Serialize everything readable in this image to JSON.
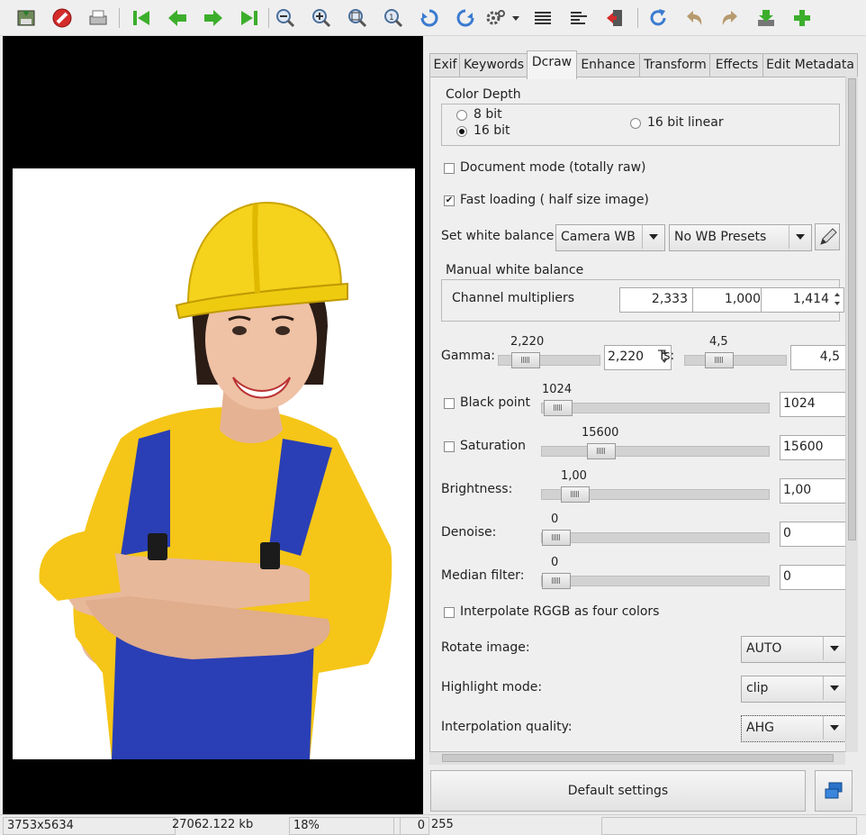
{
  "tabs": [
    "Exif",
    "Keywords",
    "Dcraw",
    "Enhance",
    "Transform",
    "Effects",
    "Edit Metadata"
  ],
  "active_tab": "Dcraw",
  "color_depth": {
    "title": "Color Depth",
    "opt_8bit": "8 bit",
    "opt_16bit": "16 bit",
    "opt_16bit_linear": "16 bit linear",
    "selected": "16 bit"
  },
  "document_mode": {
    "label": "Document mode (totally raw)",
    "checked": false
  },
  "fast_loading": {
    "label": "Fast loading ( half size image)",
    "checked": true
  },
  "white_balance": {
    "label": "Set white balance:",
    "mode": "Camera WB",
    "preset": "No WB Presets"
  },
  "manual_wb": {
    "title": "Manual white balance",
    "label": "Channel multipliers",
    "values": [
      "2,333",
      "1,000",
      "1,414"
    ]
  },
  "gamma": {
    "label": "Gamma:",
    "value": "2,220",
    "value_box": "2,220",
    "ts_label": "Ts:",
    "ts_value": "4,5",
    "ts_box": "4,5"
  },
  "black_point": {
    "label": "Black point",
    "value": "1024",
    "box": "1024",
    "checked": false
  },
  "saturation": {
    "label": "Saturation",
    "value": "15600",
    "box": "15600",
    "checked": false
  },
  "brightness": {
    "label": "Brightness:",
    "value": "1,00",
    "box": "1,00"
  },
  "denoise": {
    "label": "Denoise:",
    "value": "0",
    "box": "0"
  },
  "median": {
    "label": "Median filter:",
    "value": "0",
    "box": "0"
  },
  "interpolate_rggb": {
    "label": "Interpolate RGGB as four colors",
    "checked": false
  },
  "rotate": {
    "label": "Rotate image:",
    "value": "AUTO"
  },
  "highlight": {
    "label": "Highlight mode:",
    "value": "clip"
  },
  "interp_quality": {
    "label": "Interpolation quality:",
    "value": "AHG"
  },
  "default_button": "Default settings",
  "status": {
    "dimensions": "3753x5634",
    "size": "27062.122 kb",
    "zoom": "18%",
    "value_a": "0",
    "value_b": "255"
  },
  "colors": {
    "toolbar_green": "#3cae2c",
    "toolbar_blue": "#3a7bd0",
    "stop_red": "#d42b2b"
  }
}
